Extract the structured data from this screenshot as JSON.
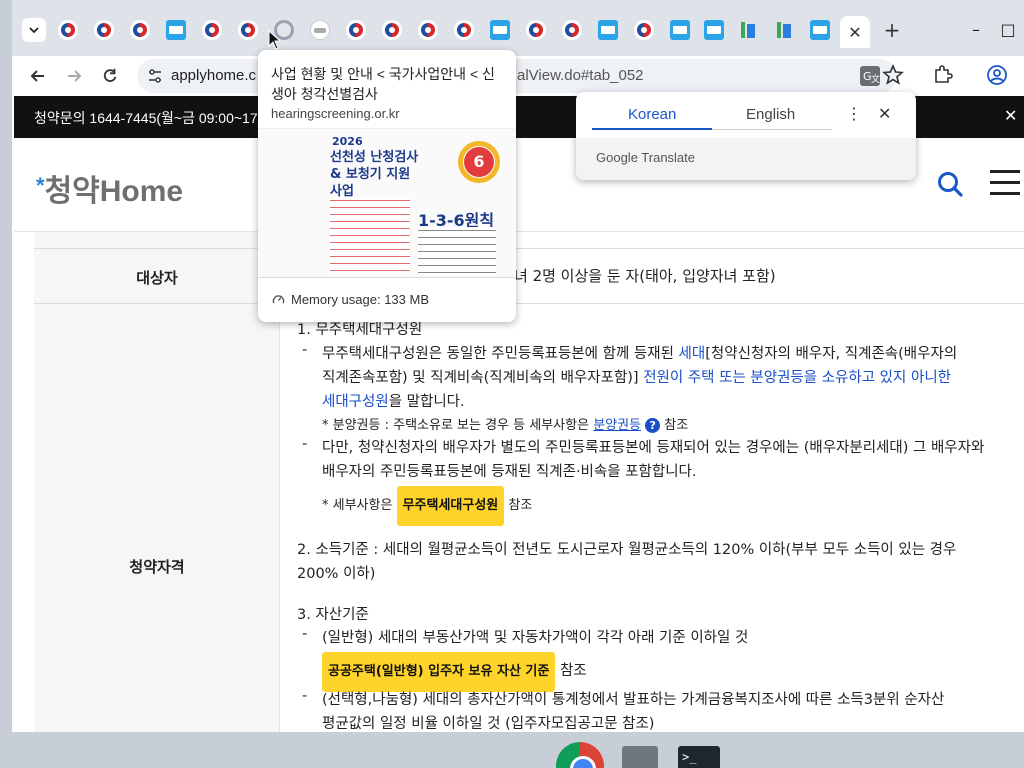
{
  "browser": {
    "tab_count_hint": "many",
    "new_tab": "+",
    "active_tab_close": "✕",
    "window_controls": {
      "minimize": "–",
      "maximize": "□",
      "close": "✕"
    }
  },
  "toolbar": {
    "url_host": "applyhome.c",
    "url_tail": "alView.do#tab_052"
  },
  "notice": {
    "text": "청약문의 1644-7445(월~금 09:00~17:",
    "close": "✕"
  },
  "site": {
    "logo_star": "*",
    "logo_text": "청약Home"
  },
  "table": {
    "row1_label": "대상자",
    "row1_text": "녀 2명 이상을 둔 자(태아, 입양자녀 포함)",
    "row2_label": "청약자격",
    "s1_title": "1. 무주택세대구성원",
    "s1_d1_a": "무주택세대구성원은 동일한 주민등록표등본에 함께 등재된 ",
    "s1_d1_link1": "세대",
    "s1_d1_b": "[청약신청자의 배우자, 직계존속(배우자의",
    "s1_d1_c": "직계존속포함) 및 직계비속(직계비속의 배우자포함)] ",
    "s1_d1_link2": "전원이 주택 또는 분양권등을 소유하고 있지 아니한",
    "s1_d1_link3": "세대구성원",
    "s1_d1_d": "을 말합니다.",
    "s1_note_a": "* 분양권등 : 주택소유로 보는 경우 등 세부사항은 ",
    "s1_note_link": "분양권등",
    "s1_note_q": "?",
    "s1_note_b": " 참조",
    "s1_d2_a": "다만, 청약신청자의 배우자가 별도의 주민등록표등본에 등재되어 있는 경우에는 (배우자분리세대) 그 배우자와",
    "s1_d2_b": "배우자의 주민등록표등본에 등재된 직계존·비속을 포함합니다.",
    "s1_note2_a": "* 세부사항은 ",
    "s1_note2_pill": "무주택세대구성원",
    "s1_note2_b": " 참조",
    "s2_a": "2. 소득기준 : 세대의 월평균소득이 전년도 도시근로자 월평균소득의 120% 이하(부부 모두 소득이 있는 경우",
    "s2_b": "200% 이하)",
    "s3_title": "3. 자산기준",
    "s3_d1": "(일반형) 세대의 부동산가액 및 자동차가액이 각각 아래 기준 이하일 것",
    "s3_pill": "공공주택(일반형) 입주자 보유 자산 기준",
    "s3_pill_after": " 참조",
    "s3_d2_a": "(선택형,나눔형) 세대의 총자산가액이 통계청에서 발표하는 가계금융복지조사에 따른 소득3분위 순자산",
    "s3_d2_b": "평균값의 일정 비율 이하일 것 (입주자모집공고문 참조)",
    "dash": "-"
  },
  "hovercard": {
    "title": "사업 현황 및 안내 < 국가사업안내 < 신생아 청각선별검사",
    "domain": "hearingscreening.or.kr",
    "thumb_year": "2026",
    "thumb_title": "선천성 난청검사 & 보청기 지원사업",
    "thumb_rule": "1-3-6원칙",
    "thumb_ring_num": "6",
    "memory": "Memory usage: 133 MB"
  },
  "translate": {
    "lang_source": "Korean",
    "lang_target": "English",
    "brand": "Google Translate",
    "colors": {
      "active_tab": "#1a57c8"
    }
  },
  "colors": {
    "link": "#1a4fc9",
    "pill": "#ffd42a",
    "notice_bg": "#111111"
  }
}
